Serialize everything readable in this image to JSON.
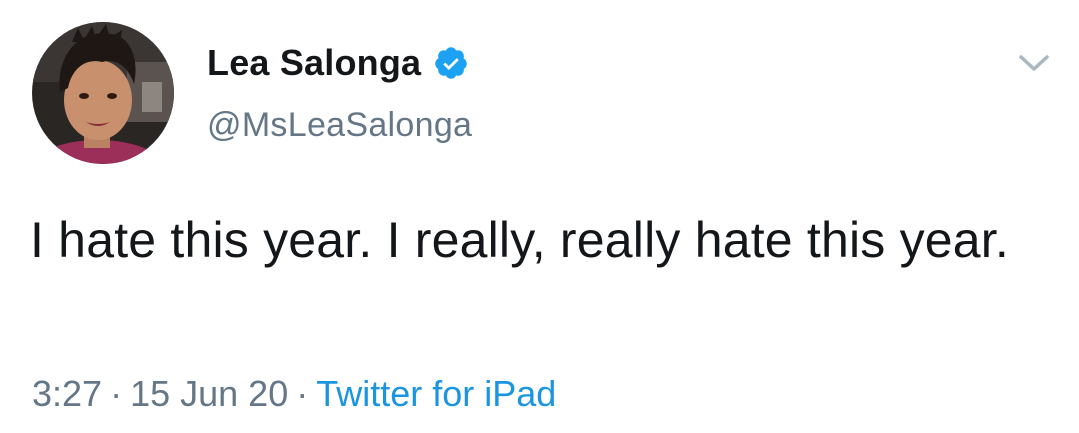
{
  "user": {
    "display_name": "Lea Salonga",
    "handle": "@MsLeaSalonga",
    "verified": true
  },
  "tweet": {
    "text": "I hate this year. I really, really hate this year.",
    "time": "3:27",
    "date": "15 Jun 20",
    "separator": "·",
    "source": "Twitter for iPad"
  },
  "icons": {
    "verified": "verified-badge-icon",
    "menu": "chevron-down-icon"
  },
  "colors": {
    "text": "#14171a",
    "secondary": "#657786",
    "link": "#1b95e0",
    "verified": "#1da1f2"
  }
}
